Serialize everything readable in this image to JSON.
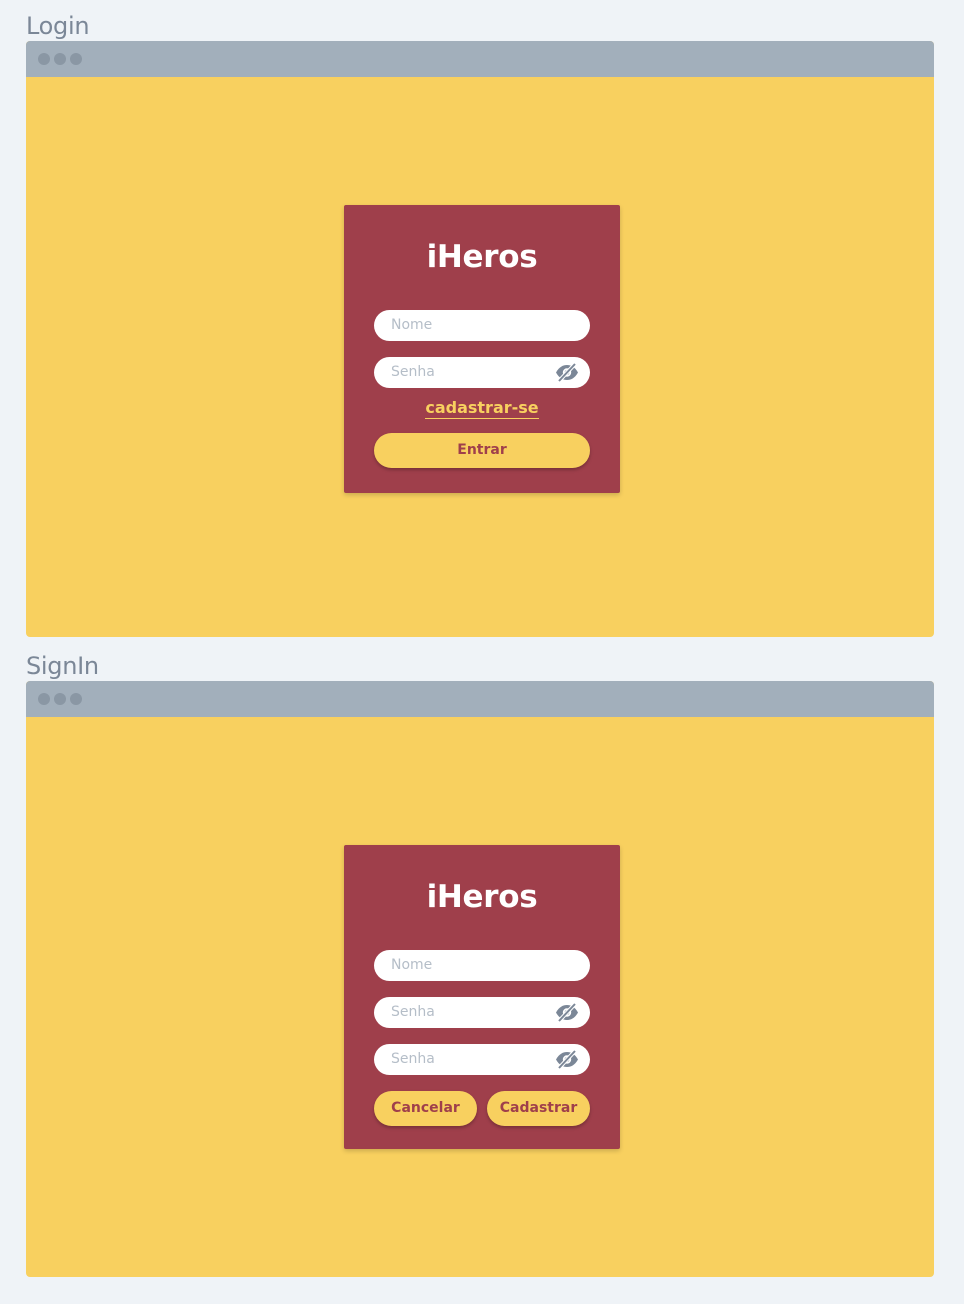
{
  "screens": [
    {
      "label": "Login",
      "brand": "iHeros",
      "name_placeholder": "Nome",
      "password_placeholder": "Senha",
      "register_link": "cadastrar-se",
      "submit_button": "Entrar"
    },
    {
      "label": "SignIn",
      "brand": "iHeros",
      "name_placeholder": "Nome",
      "password_placeholder": "Senha",
      "confirm_password_placeholder": "Senha",
      "cancel_button": "Cancelar",
      "submit_button": "Cadastrar"
    }
  ],
  "icons": {
    "password_toggle": "eye-slash-icon",
    "window_controls": "window-dot-icon"
  },
  "colors": {
    "page_background": "#eff3f7",
    "window_background": "#f8d05f",
    "titlebar": "#a2afbb",
    "card": "#9f3f4b",
    "accent_button": "#f8d05f",
    "button_text": "#9f3f4b",
    "label_text": "#7b8797"
  }
}
